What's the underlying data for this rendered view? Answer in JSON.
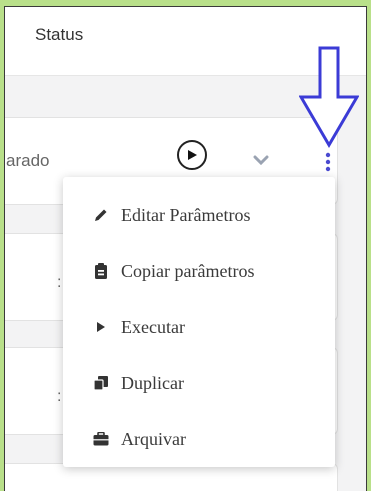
{
  "header": {
    "title": "Status"
  },
  "row": {
    "status_partial": "arado",
    "peek_char": ":"
  },
  "menu": {
    "items": [
      {
        "label": "Editar Parâmetros",
        "icon": "pencil-icon"
      },
      {
        "label": "Copiar parâmetros",
        "icon": "clipboard-icon"
      },
      {
        "label": "Executar",
        "icon": "play-icon"
      },
      {
        "label": "Duplicar",
        "icon": "duplicate-icon"
      },
      {
        "label": "Arquivar",
        "icon": "briefcase-icon"
      }
    ]
  },
  "colors": {
    "background": "#b9e08a",
    "arrow": "#3b3bd6",
    "kebab": "#4a4ad0",
    "chevron": "#9aa3b2"
  }
}
